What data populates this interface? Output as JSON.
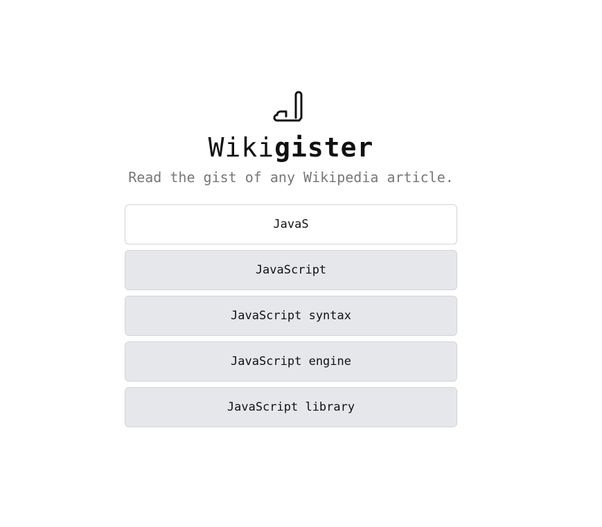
{
  "logo": {
    "icon": "pen-scroll-icon"
  },
  "brand": {
    "prefix": "Wiki",
    "suffix": "gister"
  },
  "tagline": "Read the gist of any Wikipedia article.",
  "search": {
    "value": "JavaS"
  },
  "results": [
    "JavaScript",
    "JavaScript syntax",
    "JavaScript engine",
    "JavaScript library"
  ]
}
